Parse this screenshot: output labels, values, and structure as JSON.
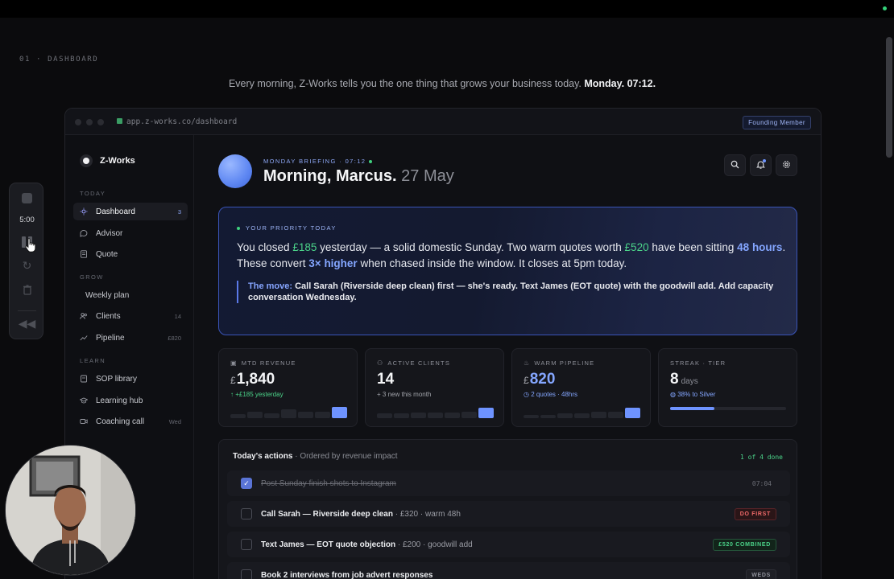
{
  "section_label": "01 · DASHBOARD",
  "tagline": {
    "text": "Every morning, Z-Works tells you the one thing that grows your business today. ",
    "emphasis": "Monday. 07:12."
  },
  "browser": {
    "url": "app.z-works.co/dashboard",
    "badge": "Founding Member"
  },
  "sidebar": {
    "brand": "Z-Works",
    "sections": [
      {
        "heading": "TODAY",
        "items": [
          {
            "label": "Dashboard",
            "count": "3",
            "icon": "sun-icon",
            "active": true
          },
          {
            "label": "Advisor",
            "count": "",
            "icon": "chat-bubble-icon"
          },
          {
            "label": "Quote",
            "count": "",
            "icon": "document-icon"
          }
        ]
      },
      {
        "heading": "GROW",
        "items": [
          {
            "label": "Weekly plan",
            "count": "",
            "icon": ""
          },
          {
            "label": "Clients",
            "count": "14",
            "icon": "users-icon"
          },
          {
            "label": "Pipeline",
            "count": "£820",
            "icon": "trend-up-icon"
          }
        ]
      },
      {
        "heading": "LEARN",
        "items": [
          {
            "label": "SOP library",
            "count": "",
            "icon": "book-icon"
          },
          {
            "label": "Learning hub",
            "count": "",
            "icon": "graduation-cap-icon"
          },
          {
            "label": "Coaching call",
            "count": "Wed",
            "icon": "video-icon"
          }
        ]
      }
    ]
  },
  "header": {
    "briefing_label": "MONDAY BRIEFING · 07:12",
    "greeting": "Morning, Marcus.",
    "date": "27 May",
    "icons": [
      "search-icon",
      "bell-icon",
      "settings-icon"
    ]
  },
  "priority": {
    "label": "YOUR PRIORITY TODAY",
    "t1": "You closed ",
    "amount1": "£185",
    "t2": " yesterday — a solid domestic Sunday. Two warm quotes worth ",
    "amount2": "£520",
    "t3": " have been sitting ",
    "hours": "48 hours",
    "t4": ". These convert ",
    "multiplier": "3× higher",
    "t5": " when chased inside the window. It closes at 5pm today.",
    "move_label": "The move:",
    "move_text": " Call Sarah (Riverside deep clean) first — she's ready. Text James (EOT quote) with the goodwill add. Add capacity conversation Wednesday."
  },
  "stats": [
    {
      "label": "MTD REVENUE",
      "icon": "wallet-icon",
      "currency": "£",
      "value": "1,840",
      "sub": "+£185 yesterday",
      "sub_icon": "↑",
      "sub_color": "green",
      "spark": [
        0.35,
        0.55,
        0.4,
        0.75,
        0.55,
        0.6,
        1.0
      ]
    },
    {
      "label": "ACTIVE CLIENTS",
      "icon": "users-icon",
      "currency": "",
      "value": "14",
      "sub": "3 new this month",
      "sub_icon": "+",
      "sub_color": "grey",
      "spark": [
        0.45,
        0.45,
        0.5,
        0.5,
        0.5,
        0.55,
        0.95
      ]
    },
    {
      "label": "WARM PIPELINE",
      "icon": "flame-icon",
      "currency": "£",
      "value": "820",
      "sub": "2 quotes · 48hrs",
      "sub_icon": "◷",
      "sub_color": "blue",
      "spark": [
        0.3,
        0.25,
        0.4,
        0.4,
        0.55,
        0.6,
        0.9
      ]
    },
    {
      "label": "STREAK · TIER",
      "icon": "",
      "currency": "",
      "value": "8",
      "unit": "days",
      "sub": "38% to Silver",
      "sub_icon": "◍",
      "sub_color": "blue",
      "progress": 0.38
    }
  ],
  "actions": {
    "title": "Today's actions",
    "subtitle": " · Ordered by revenue impact",
    "done": "1 of 4 done",
    "rows": [
      {
        "title": "Post Sunday finish shots to Instagram",
        "detail": "",
        "tag": "07:04",
        "tag_style": "time",
        "checked": true
      },
      {
        "title": "Call Sarah — Riverside deep clean",
        "detail": " · £320 · warm 48h",
        "tag": "DO FIRST",
        "tag_style": "red",
        "checked": false
      },
      {
        "title": "Text James — EOT quote objection",
        "detail": " · £200 · goodwill add",
        "tag": "£520 COMBINED",
        "tag_style": "green",
        "checked": false
      },
      {
        "title": "Book 2 interviews from job advert responses",
        "detail": "",
        "tag": "WEDS",
        "tag_style": "grey",
        "checked": false
      }
    ]
  },
  "recorder": {
    "time": "5:00"
  }
}
